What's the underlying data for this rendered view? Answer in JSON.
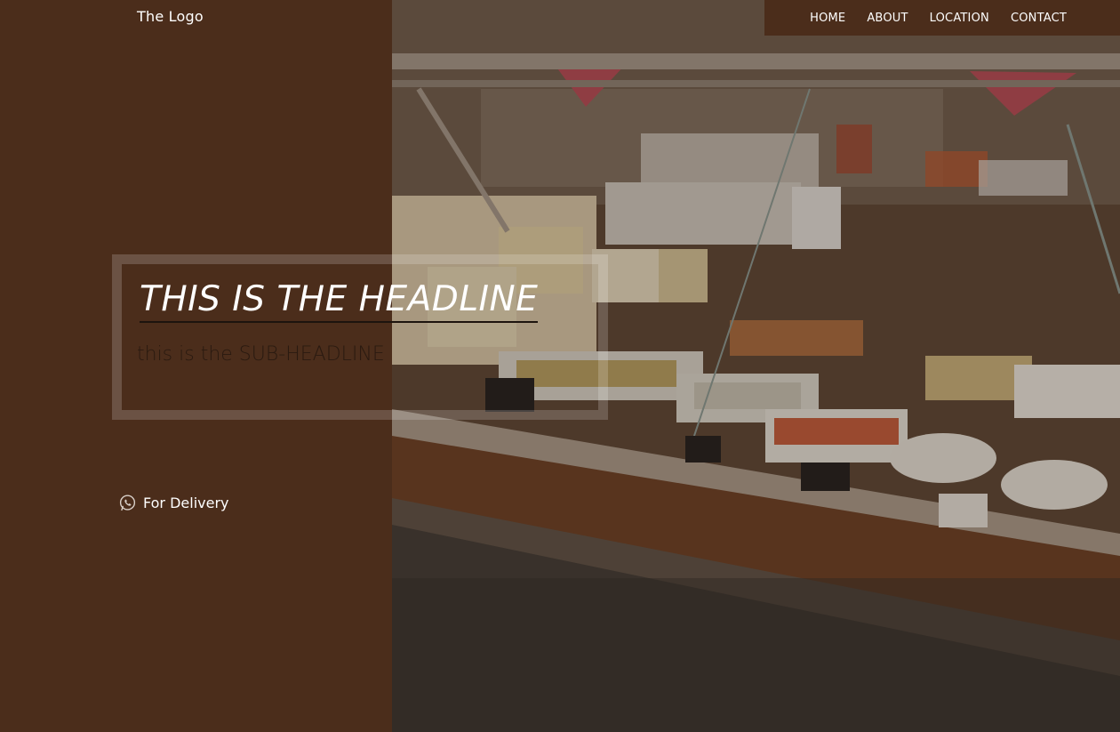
{
  "logo": {
    "text": "The Logo"
  },
  "nav": {
    "items": [
      {
        "label": "HOME"
      },
      {
        "label": "ABOUT"
      },
      {
        "label": "LOCATION"
      },
      {
        "label": "CONTACT"
      }
    ]
  },
  "hero": {
    "headline": "THIS IS THE HEADLINE",
    "subheadline": "this is the SUB-HEADLINE",
    "image_icon": "deli-counter-photo"
  },
  "delivery": {
    "label": "For Delivery",
    "icon": "whatsapp-icon"
  },
  "colors": {
    "brand_brown": "#4b2d1b",
    "text_white": "#ffffff",
    "subheadline": "#2a1a10"
  }
}
